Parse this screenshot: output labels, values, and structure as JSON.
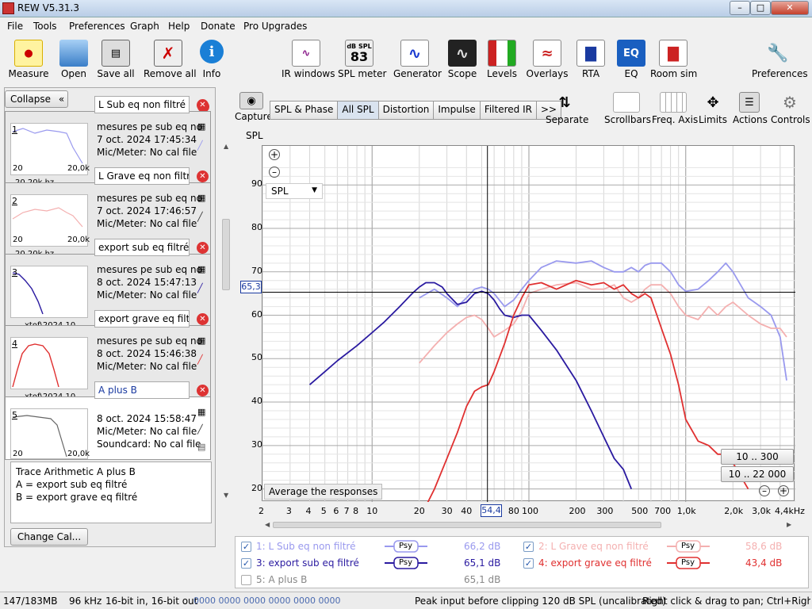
{
  "window": {
    "title": "REW V5.31.3"
  },
  "menu": [
    "File",
    "Tools",
    "Preferences",
    "Graph",
    "Help",
    "Donate",
    "Pro Upgrades"
  ],
  "toolbar": {
    "measure": "Measure",
    "open": "Open",
    "save_all": "Save all",
    "remove_all": "Remove all",
    "info": "Info",
    "ir_windows": "IR windows",
    "spl_meter": "SPL meter",
    "spl_meter_top": "dB SPL",
    "spl_meter_value": "83",
    "generator": "Generator",
    "scope": "Scope",
    "levels": "Levels",
    "overlays": "Overlays",
    "rta": "RTA",
    "eq": "EQ",
    "room_sim": "Room sim",
    "preferences": "Preferences"
  },
  "left": {
    "collapse": "Collapse",
    "measurements": [
      {
        "num": "1",
        "name": "L Sub eq non filtré",
        "l1": "mesures pe sub eq no",
        "l2": "7 oct. 2024 17:45:34",
        "l3": "Mic/Meter: No cal file",
        "tick_l": "20",
        "tick_r": "20,0k",
        "bottom": "20 20k hz"
      },
      {
        "num": "2",
        "name": "L Grave eq non filtré",
        "l1": "mesures pe sub eq no",
        "l2": "7 oct. 2024 17:46:57",
        "l3": "Mic/Meter: No cal file",
        "tick_l": "20",
        "tick_r": "20,0k",
        "bottom": "20 20k hz"
      },
      {
        "num": "3",
        "name": "export sub eq filtré",
        "l1": "mesures pe sub eq no",
        "l2": "8 oct. 2024 15:47:13",
        "l3": "Mic/Meter: No cal file",
        "tick_l": "",
        "tick_r": "",
        "bottom": "xtof\\2024 10"
      },
      {
        "num": "4",
        "name": "export grave eq filtré",
        "l1": "mesures pe sub eq no",
        "l2": "8 oct. 2024 15:46:38",
        "l3": "Mic/Meter: No cal file",
        "tick_l": "",
        "tick_r": "",
        "bottom": "xtof\\2024 10"
      },
      {
        "num": "5",
        "name": "A plus B",
        "l1": "8 oct. 2024 15:58:47",
        "l2": "Mic/Meter: No cal file",
        "l3": "Soundcard: No cal file",
        "tick_l": "20",
        "tick_r": "20,0k",
        "bottom": ""
      }
    ],
    "notes": [
      "Trace Arithmetic A plus B",
      "A = export sub eq filtré",
      "B = export grave eq filtré"
    ],
    "change_cal": "Change Cal..."
  },
  "graph": {
    "capture": "Capture",
    "tabs": [
      "SPL & Phase",
      "All SPL",
      "Distortion",
      "Impulse",
      "Filtered IR",
      ">>"
    ],
    "active_tab": "All SPL",
    "right_tools": [
      "Separate",
      "Scrollbars",
      "Freq. Axis",
      "Limits",
      "Actions",
      "Controls"
    ],
    "y_unit": "SPL",
    "dropdown": "SPL",
    "cursor_y": "65,3",
    "cursor_x": "54,4",
    "avg_button": "Average the responses",
    "range_btn1": "10 .. 300",
    "range_btn2": "10 .. 22 000"
  },
  "chart_data": {
    "type": "line",
    "ylabel": "SPL",
    "xlabel": "",
    "x_scale": "log",
    "xlim": [
      2,
      5000
    ],
    "ylim": [
      17,
      99
    ],
    "y_ticks": [
      "90",
      "80",
      "70",
      "60",
      "50",
      "40",
      "30",
      "20"
    ],
    "x_ticks": [
      "2",
      "3",
      "4",
      "5",
      "6",
      "7",
      "8",
      "10",
      "20",
      "30",
      "40",
      "80",
      "100",
      "200",
      "300",
      "500",
      "700",
      "1,0k",
      "2,0k",
      "3,0k",
      "4,4kHz"
    ],
    "series": [
      {
        "name": "1: L Sub eq non filtré",
        "color": "#9999ee",
        "x": [
          20,
          25,
          30,
          35,
          40,
          45,
          50,
          55,
          60,
          70,
          80,
          90,
          100,
          120,
          150,
          200,
          250,
          300,
          350,
          400,
          450,
          500,
          550,
          600,
          700,
          800,
          900,
          1000,
          1200,
          1400,
          1600,
          1800,
          2000,
          2500,
          3000,
          3500,
          4000,
          4400
        ],
        "y": [
          64,
          66,
          64,
          62,
          64,
          66,
          66.5,
          66,
          65,
          62,
          63.5,
          66,
          68,
          71,
          72.5,
          72,
          72.5,
          71,
          70,
          70,
          71,
          70,
          71.5,
          72,
          72,
          70,
          67,
          65.5,
          66,
          68,
          70,
          72,
          70,
          64,
          62,
          60,
          55,
          45
        ]
      },
      {
        "name": "2: L Grave eq non filtré",
        "color": "#f4b0b0",
        "x": [
          20,
          25,
          30,
          35,
          40,
          45,
          50,
          55,
          60,
          70,
          80,
          90,
          100,
          120,
          150,
          200,
          250,
          300,
          350,
          400,
          450,
          500,
          550,
          600,
          700,
          800,
          900,
          1000,
          1200,
          1400,
          1600,
          1800,
          2000,
          2500,
          3000,
          3500,
          4000,
          4400
        ],
        "y": [
          49,
          53,
          56,
          58,
          59.5,
          60,
          59,
          57,
          55,
          56.5,
          58,
          61,
          65,
          66,
          67,
          67.5,
          66,
          66,
          67,
          64,
          63,
          64,
          66,
          67,
          67,
          65,
          62,
          60,
          59,
          62,
          60,
          62,
          63,
          60,
          58,
          57,
          57,
          55
        ]
      },
      {
        "name": "3: export sub eq filtré",
        "color": "#2a1aa0",
        "x": [
          4,
          5,
          6,
          8,
          10,
          12,
          15,
          18,
          20,
          22,
          25,
          28,
          30,
          35,
          40,
          45,
          50,
          55,
          60,
          65,
          70,
          80,
          90,
          100,
          120,
          150,
          200,
          250,
          300,
          350,
          400,
          450
        ],
        "y": [
          44,
          47,
          49.5,
          53,
          56,
          58.5,
          62,
          65,
          66.5,
          67.5,
          67.5,
          66.5,
          65,
          62.5,
          63,
          65,
          65.5,
          65,
          63.5,
          61.5,
          60,
          59.5,
          60,
          60,
          56.5,
          52,
          45,
          38,
          32,
          27,
          24.5,
          20
        ]
      },
      {
        "name": "4: export grave eq filtré",
        "color": "#e03030",
        "x": [
          20,
          25,
          30,
          35,
          40,
          45,
          50,
          55,
          60,
          70,
          80,
          90,
          100,
          120,
          150,
          200,
          250,
          300,
          350,
          400,
          450,
          500,
          550,
          600,
          700,
          800,
          900,
          1000,
          1200,
          1400,
          1600,
          1800,
          2000,
          2500
        ],
        "y": [
          13,
          20,
          27,
          33,
          39,
          42.5,
          43.5,
          44,
          47,
          53.5,
          60,
          64,
          67,
          67.5,
          66,
          68,
          67,
          67.5,
          66,
          67,
          65,
          64,
          65,
          64,
          57,
          51,
          44,
          36,
          31,
          30,
          28,
          28,
          26,
          20
        ]
      },
      {
        "name": "5: A plus B",
        "color": "#888888",
        "x": [],
        "y": []
      }
    ]
  },
  "legend": [
    {
      "label": "1: L Sub eq non filtré",
      "checked": true,
      "psy": "Psy",
      "db": "66,2 dB",
      "color": "#9999ee"
    },
    {
      "label": "2: L Grave eq non filtré",
      "checked": true,
      "psy": "Psy",
      "db": "58,6 dB",
      "color": "#f4b0b0"
    },
    {
      "label": "3: export sub eq filtré",
      "checked": true,
      "psy": "Psy",
      "db": "65,1 dB",
      "color": "#2a1aa0"
    },
    {
      "label": "4: export grave eq filtré",
      "checked": true,
      "psy": "Psy",
      "db": "43,4 dB",
      "color": "#e03030"
    },
    {
      "label": "5: A plus B",
      "checked": false,
      "psy": "",
      "db": "65,1 dB",
      "color": "#888888"
    }
  ],
  "status": {
    "memory": "147/183MB",
    "rate": "96 kHz",
    "bits": "16-bit in, 16-bit out",
    "levels": "0000 0000 0000 0000 0000 0000",
    "clip": "Peak input before clipping 120 dB SPL (uncalibrated)",
    "hint": "Right click & drag to pan; Ctrl+Right click"
  }
}
